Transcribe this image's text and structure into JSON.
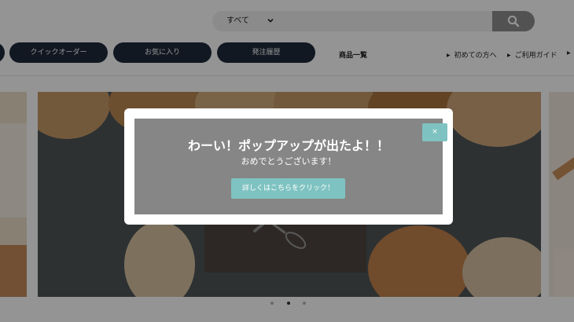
{
  "header": {
    "search": {
      "scope_label": "すべて",
      "placeholder": ""
    },
    "nav_buttons": [
      {
        "label": ""
      },
      {
        "label": "クイックオーダー"
      },
      {
        "label": "お気に入り"
      },
      {
        "label": "発注履歴"
      }
    ],
    "product_list_link": "商品一覧",
    "utility_links": [
      {
        "label": "初めての方へ"
      },
      {
        "label": "ご利用ガイド"
      },
      {
        "label": ""
      }
    ]
  },
  "carousel": {
    "slide_count": 3,
    "active_index": 1
  },
  "popup": {
    "title": "わーい！ポップアップが出たよ！！",
    "message": "おめでとうございます！",
    "cta_label": "詳しくはこちらをクリック！",
    "close_label": "×"
  },
  "colors": {
    "nav_button": "#1f2a3c",
    "accent": "#7ec3c1",
    "popup_panel": "#868686"
  }
}
